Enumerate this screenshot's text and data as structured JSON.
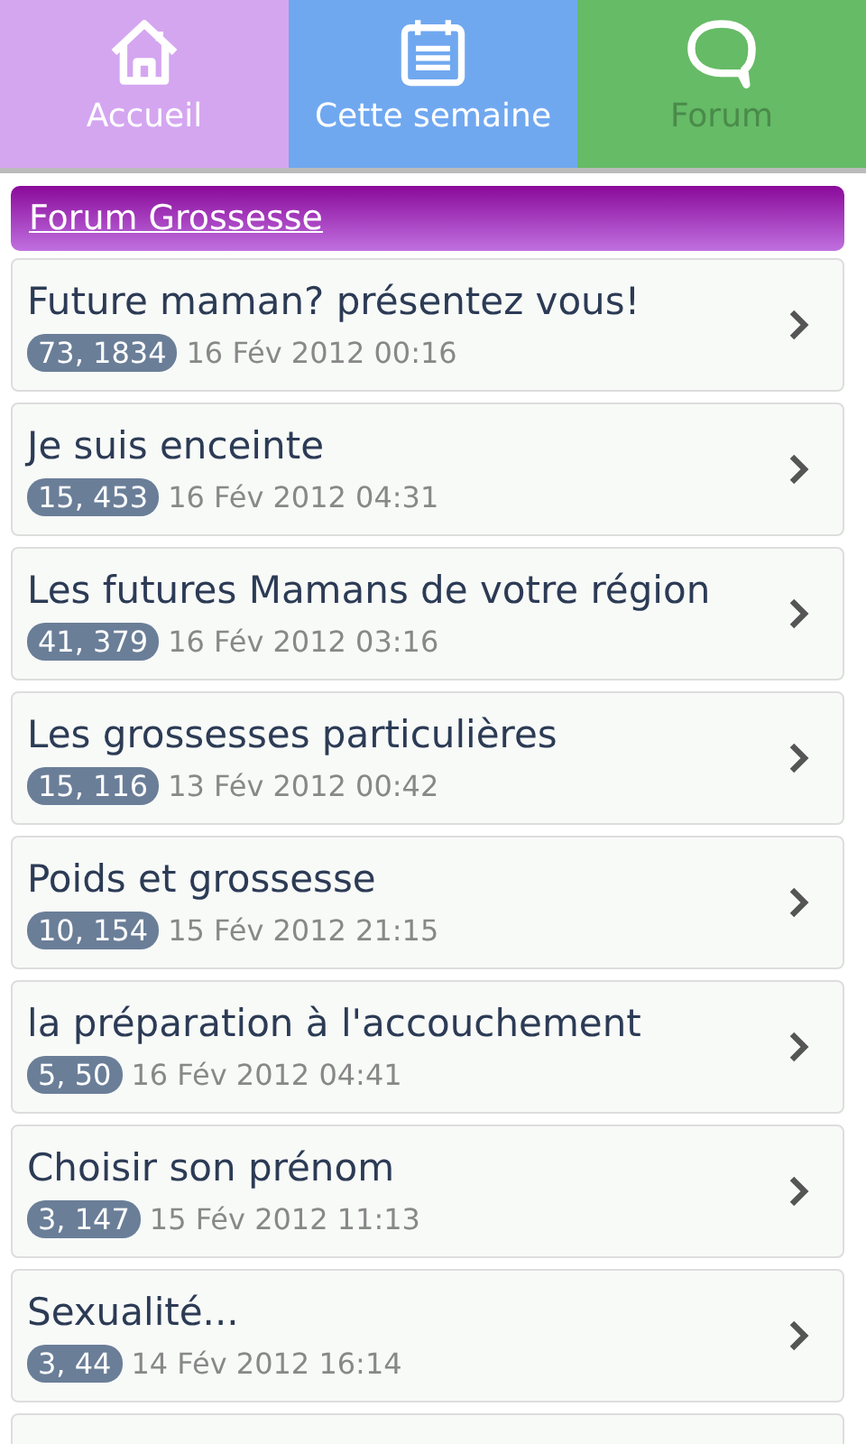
{
  "tabs": [
    {
      "label": "Accueil",
      "color": "#d4a6f0",
      "selected": false
    },
    {
      "label": "Cette semaine",
      "color": "#70a8f0",
      "selected": false
    },
    {
      "label": "Forum",
      "color": "#66bb66",
      "selected": true
    }
  ],
  "section_title": "Forum Grossesse",
  "topics": [
    {
      "title": "Future maman? présentez vous!",
      "counts": "73, 1834",
      "date": "16 Fév 2012 00:16"
    },
    {
      "title": "Je suis enceinte",
      "counts": "15, 453",
      "date": "16 Fév 2012 04:31"
    },
    {
      "title": "Les futures Mamans de votre région",
      "counts": "41, 379",
      "date": "16 Fév 2012 03:16"
    },
    {
      "title": "Les grossesses particulières",
      "counts": "15, 116",
      "date": "13 Fév 2012 00:42"
    },
    {
      "title": "Poids et grossesse",
      "counts": "10, 154",
      "date": "15 Fév 2012 21:15"
    },
    {
      "title": "la préparation à l'accouchement",
      "counts": "5, 50",
      "date": "16 Fév 2012 04:41"
    },
    {
      "title": "Choisir son prénom",
      "counts": "3, 147",
      "date": "15 Fév 2012 11:13"
    },
    {
      "title": "Sexualité...",
      "counts": "3, 44",
      "date": "14 Fév 2012 16:14"
    }
  ]
}
